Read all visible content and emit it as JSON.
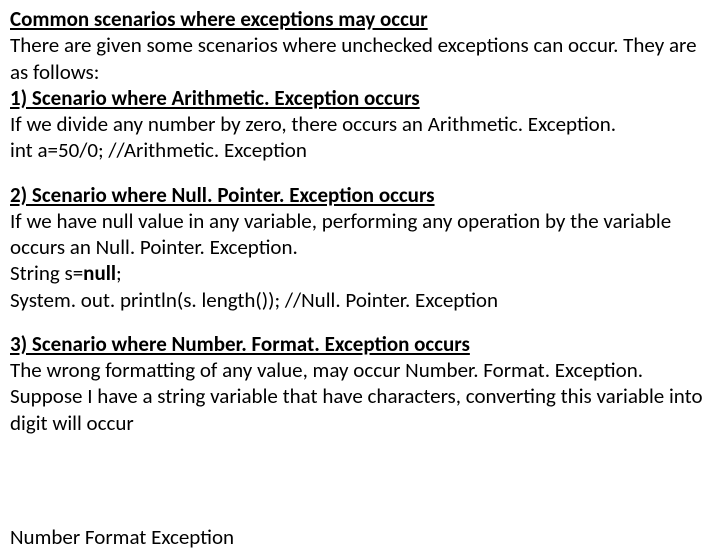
{
  "title": "Common scenarios where exceptions may occur",
  "intro": "There are given some scenarios where unchecked exceptions can occur. They are as follows:",
  "sections": [
    {
      "heading": "1) Scenario where Arithmetic. Exception occurs",
      "body": "If we divide any number by zero, there occurs an Arithmetic. Exception.",
      "code_lines": [
        {
          "pre": "int a=50/0; //Arithmetic. Exception",
          "bold": "",
          "post": ""
        }
      ]
    },
    {
      "heading": "2) Scenario where Null. Pointer. Exception occurs",
      "body": "If we have null value in any variable, performing any operation by the variable occurs an Null. Pointer. Exception.",
      "code_lines": [
        {
          "pre": "String s=",
          "bold": "null",
          "post": ";"
        },
        {
          "pre": "System. out. println(s. length()); //Null. Pointer. Exception",
          "bold": "",
          "post": ""
        }
      ]
    },
    {
      "heading": "3) Scenario where Number. Format. Exception occurs",
      "body": "The wrong formatting of any value, may occur Number. Format. Exception. Suppose I have a string variable that have characters, converting this variable into digit will occur",
      "code_lines": []
    }
  ],
  "cutoff": "Number Format Exception"
}
